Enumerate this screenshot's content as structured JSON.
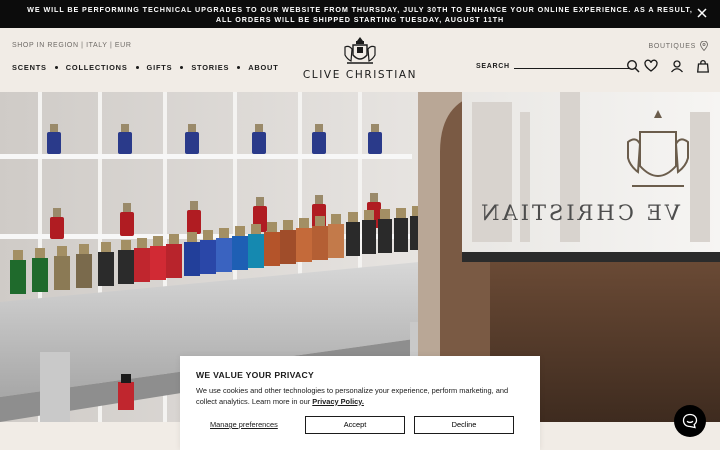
{
  "announcement": {
    "text": "We will be performing technical upgrades to our website from Thursday, July 30th to enhance your online experience. As a result, all orders will be shipped starting Tuesday, August 11th"
  },
  "header": {
    "region": "SHOP IN REGION | ITALY | EUR",
    "nav": [
      "SCENTS",
      "COLLECTIONS",
      "GIFTS",
      "STORIES",
      "ABOUT"
    ],
    "logo_text": "CLIVE CHRISTIAN",
    "boutiques_label": "BOUTIQUES",
    "search_label": "SEARCH",
    "icons": [
      "search-icon",
      "heart-icon",
      "account-icon",
      "bag-icon"
    ]
  },
  "hero": {
    "wall_sign": "VE CHRISTIAN"
  },
  "cookie": {
    "title": "WE VALUE YOUR PRIVACY",
    "text": "We use cookies and other technologies to personalize your experience, perform marketing, and collect analytics. Learn more in our ",
    "link": "Privacy Policy.",
    "manage": "Manage preferences",
    "accept": "Accept",
    "decline": "Decline"
  },
  "colors": {
    "background": "#f1ece6",
    "announcement_bg": "#0c0c0c",
    "text": "#1b1b1b"
  }
}
